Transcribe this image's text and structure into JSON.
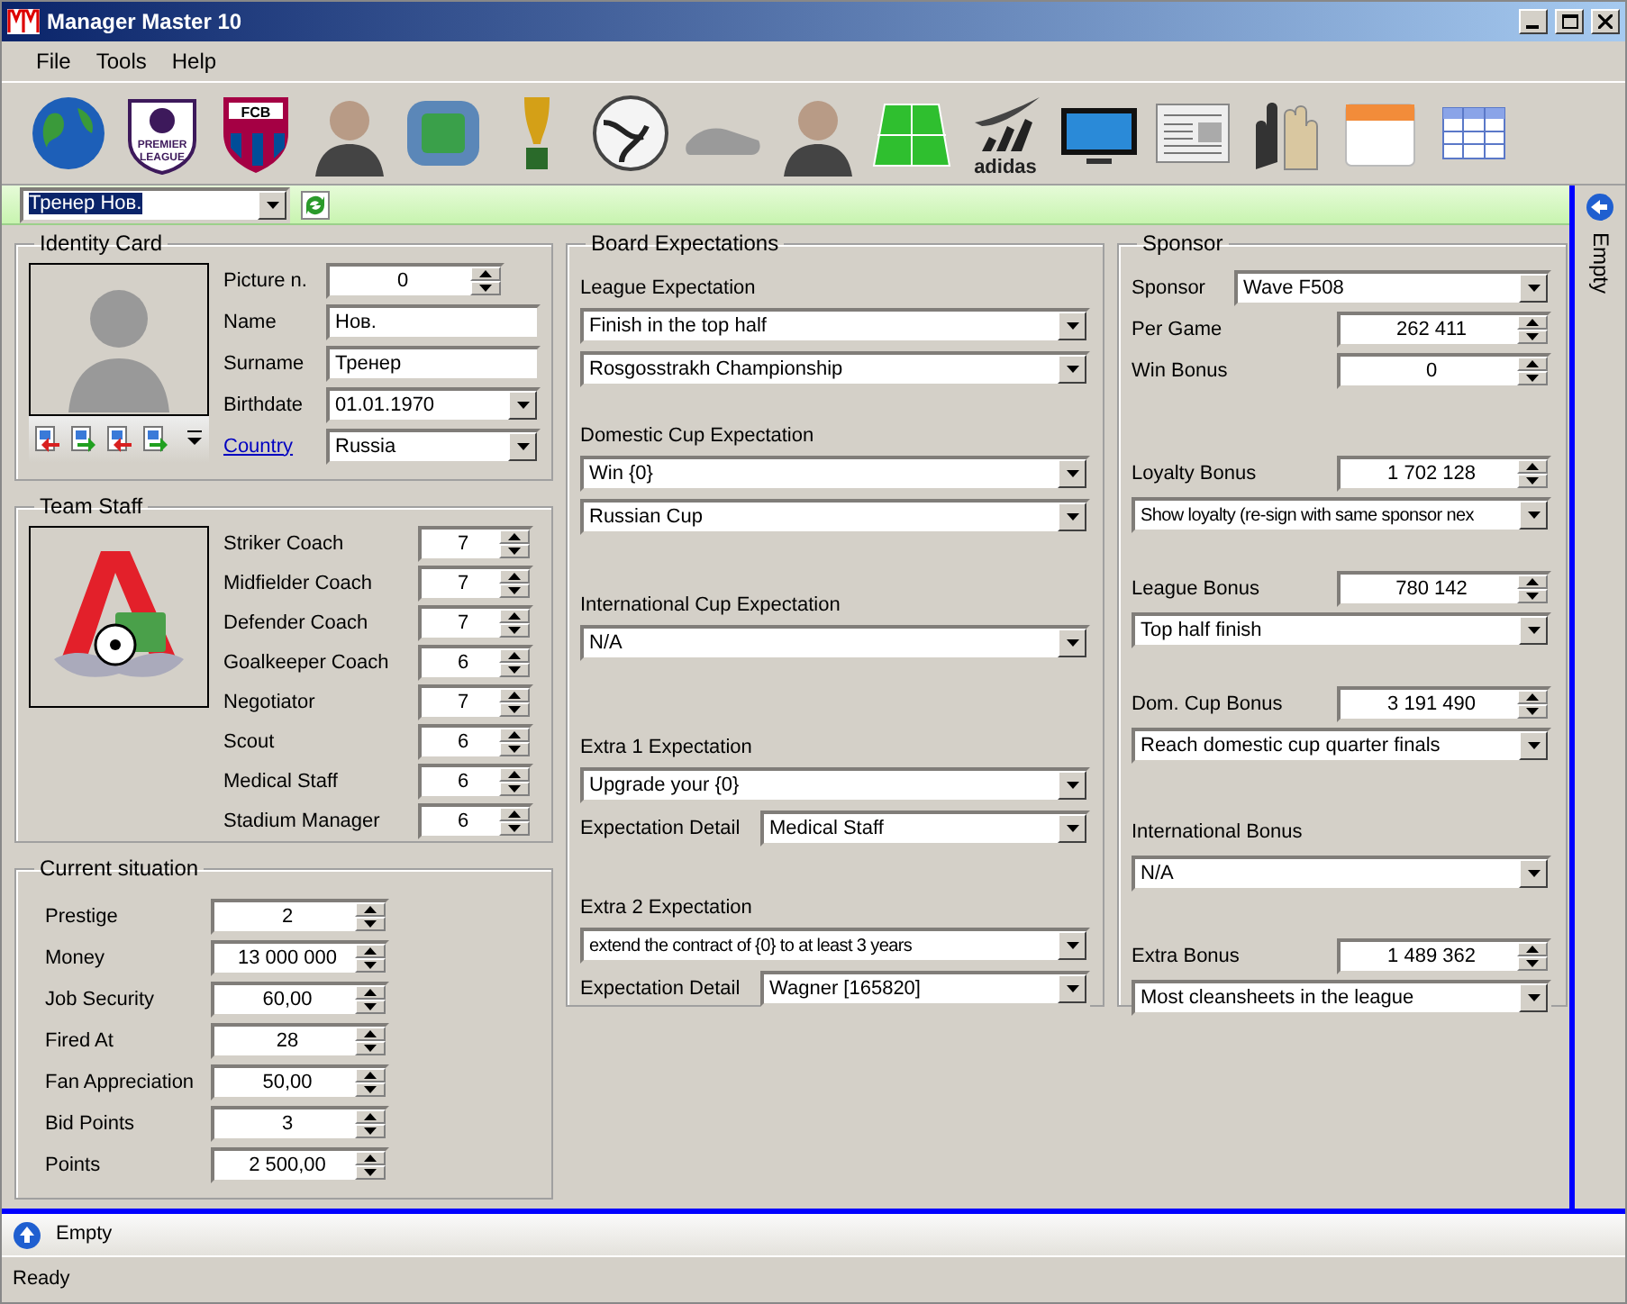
{
  "window": {
    "title": "Manager Master 10"
  },
  "menu": [
    {
      "label": "File"
    },
    {
      "label": "Tools"
    },
    {
      "label": "Help"
    }
  ],
  "toolbar": [
    {
      "kind": "globe"
    },
    {
      "kind": "crest",
      "text": "PREMIER LEAGUE"
    },
    {
      "kind": "club",
      "text": "FCB"
    },
    {
      "kind": "player"
    },
    {
      "kind": "stadium"
    },
    {
      "kind": "trophy"
    },
    {
      "kind": "ball"
    },
    {
      "kind": "boots"
    },
    {
      "kind": "manager"
    },
    {
      "kind": "pitch"
    },
    {
      "kind": "brand",
      "text": "adidas"
    },
    {
      "kind": "tv"
    },
    {
      "kind": "newspaper"
    },
    {
      "kind": "gloves"
    },
    {
      "kind": "calendar"
    },
    {
      "kind": "table"
    }
  ],
  "selector": {
    "value": "Тренер Нов."
  },
  "identity_card": {
    "title": "Identity Card",
    "fields": [
      {
        "kind": "spin",
        "label": "Picture n.",
        "value": "0",
        "link": false
      },
      {
        "kind": "text",
        "label": "Name",
        "value": "Нов.",
        "link": false
      },
      {
        "kind": "text",
        "label": "Surname",
        "value": "Тренер",
        "link": false
      },
      {
        "kind": "dropdown",
        "label": "Birthdate",
        "value": "01.01.1970",
        "link": false
      },
      {
        "kind": "dropdown",
        "label": "Country",
        "value": "Russia",
        "link": true
      }
    ]
  },
  "team_staff": {
    "title": "Team Staff",
    "rows": [
      {
        "label": "Striker Coach",
        "value": "7"
      },
      {
        "label": "Midfielder Coach",
        "value": "7"
      },
      {
        "label": "Defender Coach",
        "value": "7"
      },
      {
        "label": "Goalkeeper Coach",
        "value": "6"
      },
      {
        "label": "Negotiator",
        "value": "7"
      },
      {
        "label": "Scout",
        "value": "6"
      },
      {
        "label": "Medical Staff",
        "value": "6"
      },
      {
        "label": "Stadium Manager",
        "value": "6"
      }
    ]
  },
  "current_situation": {
    "title": "Current situation",
    "rows": [
      {
        "label": "Prestige",
        "value": "2"
      },
      {
        "label": "Money",
        "value": "13 000 000"
      },
      {
        "label": "Job Security",
        "value": "60,00"
      },
      {
        "label": "Fired At",
        "value": "28"
      },
      {
        "label": "Fan Appreciation",
        "value": "50,00"
      },
      {
        "label": "Bid Points",
        "value": "3"
      },
      {
        "label": "Points",
        "value": "2 500,00"
      }
    ]
  },
  "board_expectations": {
    "title": "Board Expectations",
    "sections": [
      {
        "label": "League Expectation",
        "rows": [
          {
            "kind": "dropdown",
            "value": "Finish in the top half"
          },
          {
            "kind": "dropdown",
            "value": "Rosgosstrakh Championship"
          }
        ]
      },
      {
        "label": "Domestic Cup Expectation",
        "rows": [
          {
            "kind": "dropdown",
            "value": "Win {0}"
          },
          {
            "kind": "dropdown",
            "value": "Russian Cup"
          }
        ]
      },
      {
        "label": "International Cup Expectation",
        "rows": [
          {
            "kind": "dropdown",
            "value": "N/A"
          }
        ]
      },
      {
        "label": "Extra 1 Expectation",
        "rows": [
          {
            "kind": "dropdown",
            "value": "Upgrade your {0}"
          },
          {
            "kind": "detail",
            "label": "Expectation Detail",
            "value": "Medical Staff"
          }
        ]
      },
      {
        "label": "Extra 2 Expectation",
        "rows": [
          {
            "kind": "dropdown",
            "value": "extend the contract of {0} to at least 3 years"
          },
          {
            "kind": "detail",
            "label": "Expectation Detail",
            "value": "Wagner [165820]"
          }
        ]
      }
    ]
  },
  "sponsor": {
    "title": "Sponsor",
    "blocks": [
      [
        {
          "kind": "select",
          "label": "Sponsor",
          "value": "Wave F508"
        },
        {
          "kind": "spin",
          "label": "Per Game",
          "value": "262 411"
        },
        {
          "kind": "spin",
          "label": "Win Bonus",
          "value": "0"
        }
      ],
      [
        {
          "kind": "spin",
          "label": "Loyalty Bonus",
          "value": "1 702 128"
        },
        {
          "kind": "dropdown",
          "value": "Show loyalty (re-sign with same sponsor nex"
        }
      ],
      [
        {
          "kind": "spin",
          "label": "League Bonus",
          "value": "780 142"
        },
        {
          "kind": "dropdown",
          "value": "Top half finish"
        }
      ],
      [
        {
          "kind": "spin",
          "label": "Dom. Cup Bonus",
          "value": "3 191 490"
        },
        {
          "kind": "dropdown",
          "value": "Reach domestic cup quarter finals"
        }
      ],
      [
        {
          "kind": "label",
          "label": "International Bonus"
        },
        {
          "kind": "dropdown",
          "value": "N/A"
        }
      ],
      [
        {
          "kind": "spin",
          "label": "Extra Bonus",
          "value": "1 489 362"
        },
        {
          "kind": "dropdown",
          "value": "Most cleansheets in the league"
        }
      ]
    ]
  },
  "side_panel": {
    "label": "Empty"
  },
  "bottom_panel": {
    "label": "Empty"
  },
  "status_bar": {
    "text": "Ready"
  }
}
